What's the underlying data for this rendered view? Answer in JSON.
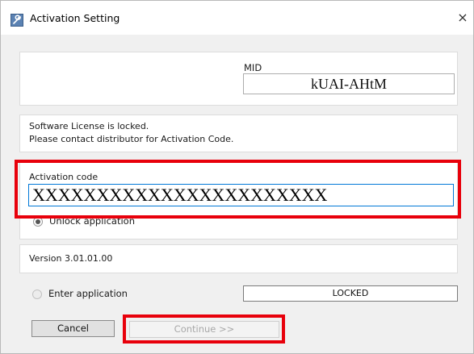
{
  "window": {
    "title": "Activation Setting",
    "close_glyph": "×",
    "icon": "wrench-app-icon"
  },
  "mid": {
    "label": "MID",
    "value": "kUAI-AHtM"
  },
  "message": {
    "line1": "Software License is locked.",
    "line2": "Please contact distributor for Activation Code."
  },
  "activation": {
    "label": "Activation code",
    "value": "XXXXXXXXXXXXXXXXXXXXXXX",
    "unlock_label": "Unlock application",
    "unlock_checked": true
  },
  "version": {
    "text": "Version   3.01.01.00"
  },
  "enter": {
    "label": "Enter application",
    "checked": false,
    "status": "LOCKED"
  },
  "buttons": {
    "cancel": "Cancel",
    "continue": "Continue >>"
  },
  "colors": {
    "highlight": "#e8000b",
    "input_focus_border": "#0078d7",
    "disabled_text": "#a8a8a8"
  }
}
